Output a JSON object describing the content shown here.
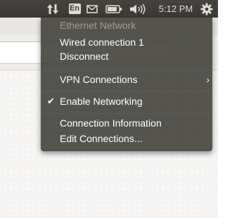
{
  "panel": {
    "keyboard_layout": "En",
    "clock": "5:12 PM",
    "icons": [
      "network-transfer-icon",
      "keyboard-layout-icon",
      "mail-icon",
      "battery-icon",
      "volume-icon",
      "system-gear-icon"
    ]
  },
  "menu": {
    "header": "Ethernet Network",
    "items": {
      "wired": "Wired connection 1",
      "disconnect": "Disconnect",
      "vpn": "VPN Connections",
      "enable_networking": "Enable Networking",
      "connection_info": "Connection Information",
      "edit_connections": "Edit Connections..."
    },
    "enable_networking_checked": true
  },
  "colors": {
    "panel": "#3c3b37",
    "menu_bg": "#484742",
    "menu_text": "#ffffff",
    "menu_header": "#9f9c95"
  }
}
